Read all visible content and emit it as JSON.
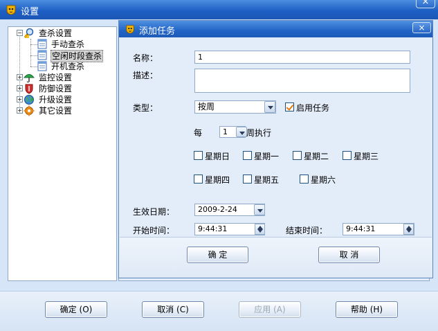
{
  "window": {
    "title": "设置",
    "close_glyph": "×"
  },
  "tree": {
    "scan": {
      "label": "查杀设置",
      "toggle": "−"
    },
    "scan_children": [
      {
        "label": "手动查杀"
      },
      {
        "label": "空闲时段查杀",
        "selected": true
      },
      {
        "label": "开机查杀"
      }
    ],
    "monitor": {
      "label": "监控设置",
      "toggle": "+"
    },
    "defense": {
      "label": "防御设置",
      "toggle": "+"
    },
    "upgrade": {
      "label": "升级设置",
      "toggle": "+"
    },
    "other": {
      "label": "其它设置",
      "toggle": "+"
    }
  },
  "dialog": {
    "title": "添加任务",
    "close_glyph": "×",
    "name_label": "名称：",
    "name_value": "1",
    "desc_label": "描述：",
    "desc_value": "",
    "type_label": "类型：",
    "type_value": "按周",
    "enable_label": "启用任务",
    "enable_checked": true,
    "every_label": "每",
    "every_value": "1",
    "week_exec_label": "周执行",
    "weekdays": [
      {
        "label": "星期日",
        "checked": false
      },
      {
        "label": "星期一",
        "checked": false
      },
      {
        "label": "星期二",
        "checked": false
      },
      {
        "label": "星期三",
        "checked": false
      },
      {
        "label": "星期四",
        "checked": false
      },
      {
        "label": "星期五",
        "checked": false
      },
      {
        "label": "星期六",
        "checked": false
      }
    ],
    "effective_date_label": "生效日期：",
    "effective_date_value": "2009-2-24",
    "start_time_label": "开始时间：",
    "start_time_value": "9:44:31",
    "end_time_label": "结束时间：",
    "end_time_value": "9:44:31",
    "ok_label": "确 定",
    "cancel_label": "取 消"
  },
  "footer": {
    "ok_label": "确定",
    "ok_key": "(O)",
    "cancel_label": "取消",
    "cancel_key": "(C)",
    "apply_label": "应用",
    "apply_key": "(A)",
    "help_label": "帮助",
    "help_key": "(H)"
  },
  "icons": {
    "app": "tiger-shield-icon",
    "scan": "magnifier-icon",
    "doc": "document-icon",
    "monitor": "umbrella-icon",
    "defense": "shield-icon",
    "upgrade": "globe-icon",
    "other": "gear-icon"
  }
}
